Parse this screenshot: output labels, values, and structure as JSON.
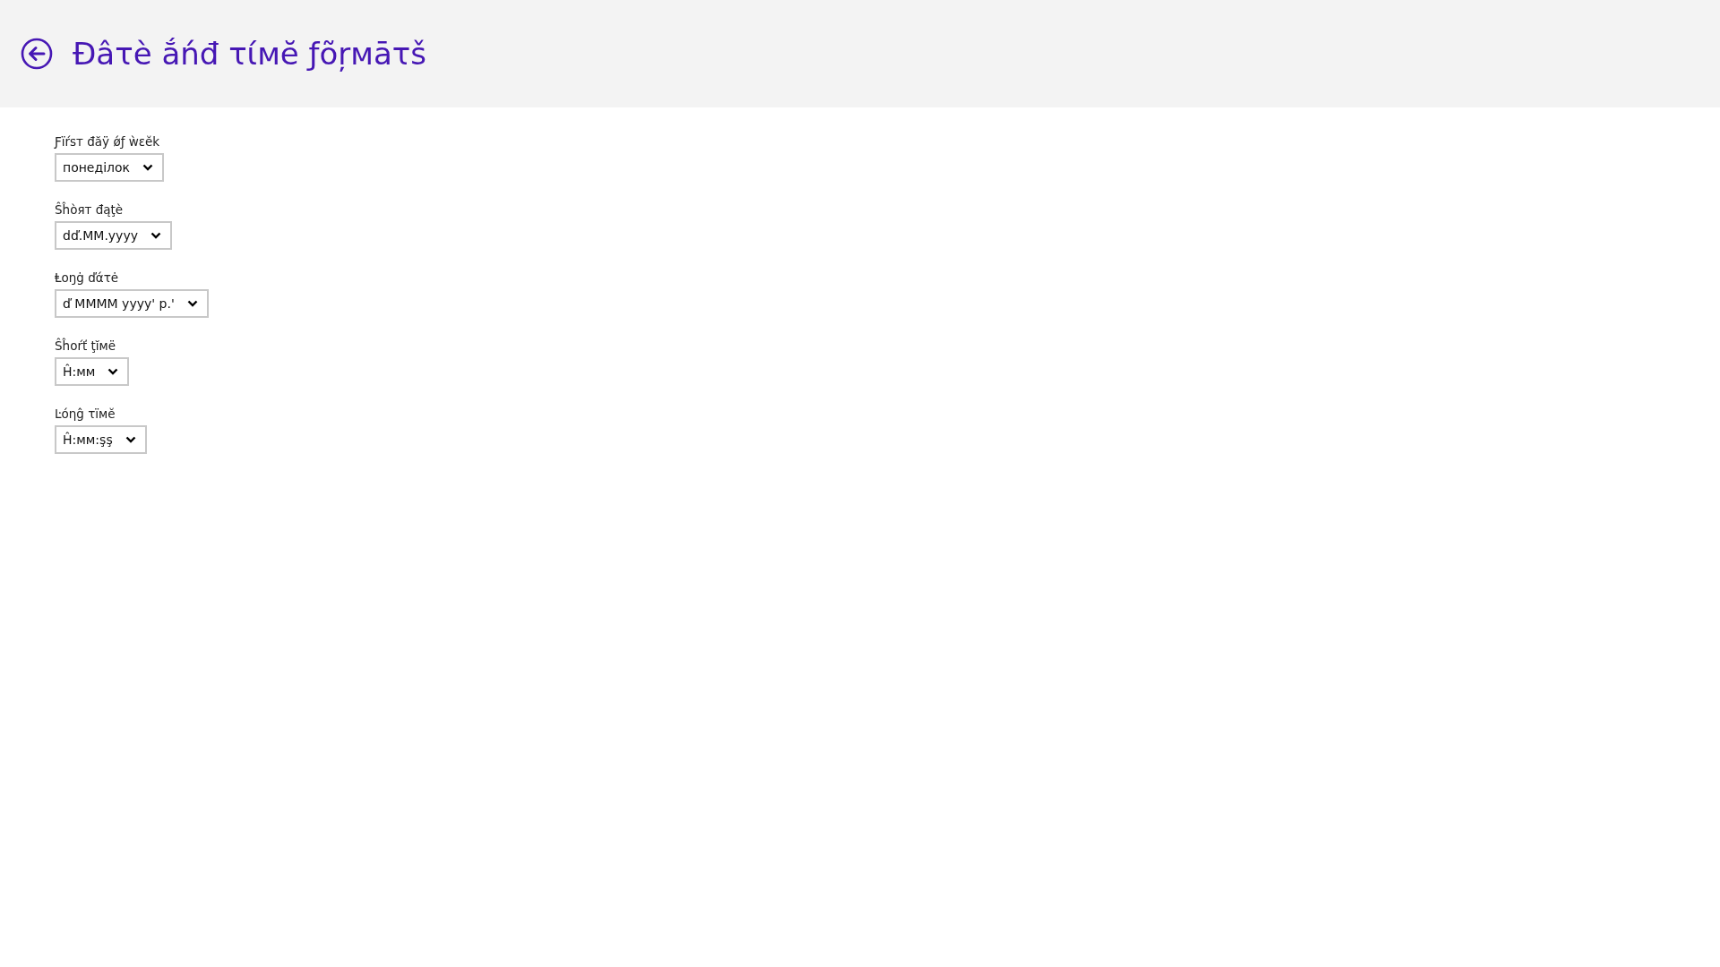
{
  "header": {
    "title": "Đâτè ắńđ τίмĕ ƒõŗмāτš"
  },
  "settings": [
    {
      "label": "Ƒïŕsт đăÿ ǿƒ ẁεĕk",
      "value": "понеділок"
    },
    {
      "label": "Ŝĥòят đąţè",
      "value": "dď.MM.yyyy"
    },
    {
      "label": "Ⱡoŋġ ďάτė",
      "value": "ď MMMM yyyy' p.'"
    },
    {
      "label": "Ŝĥoŕť ţĭмë",
      "value": "Ĥ:мм"
    },
    {
      "label": "Ŀόηĝ τïмĕ",
      "value": "Ĥ:мм:şş"
    }
  ]
}
